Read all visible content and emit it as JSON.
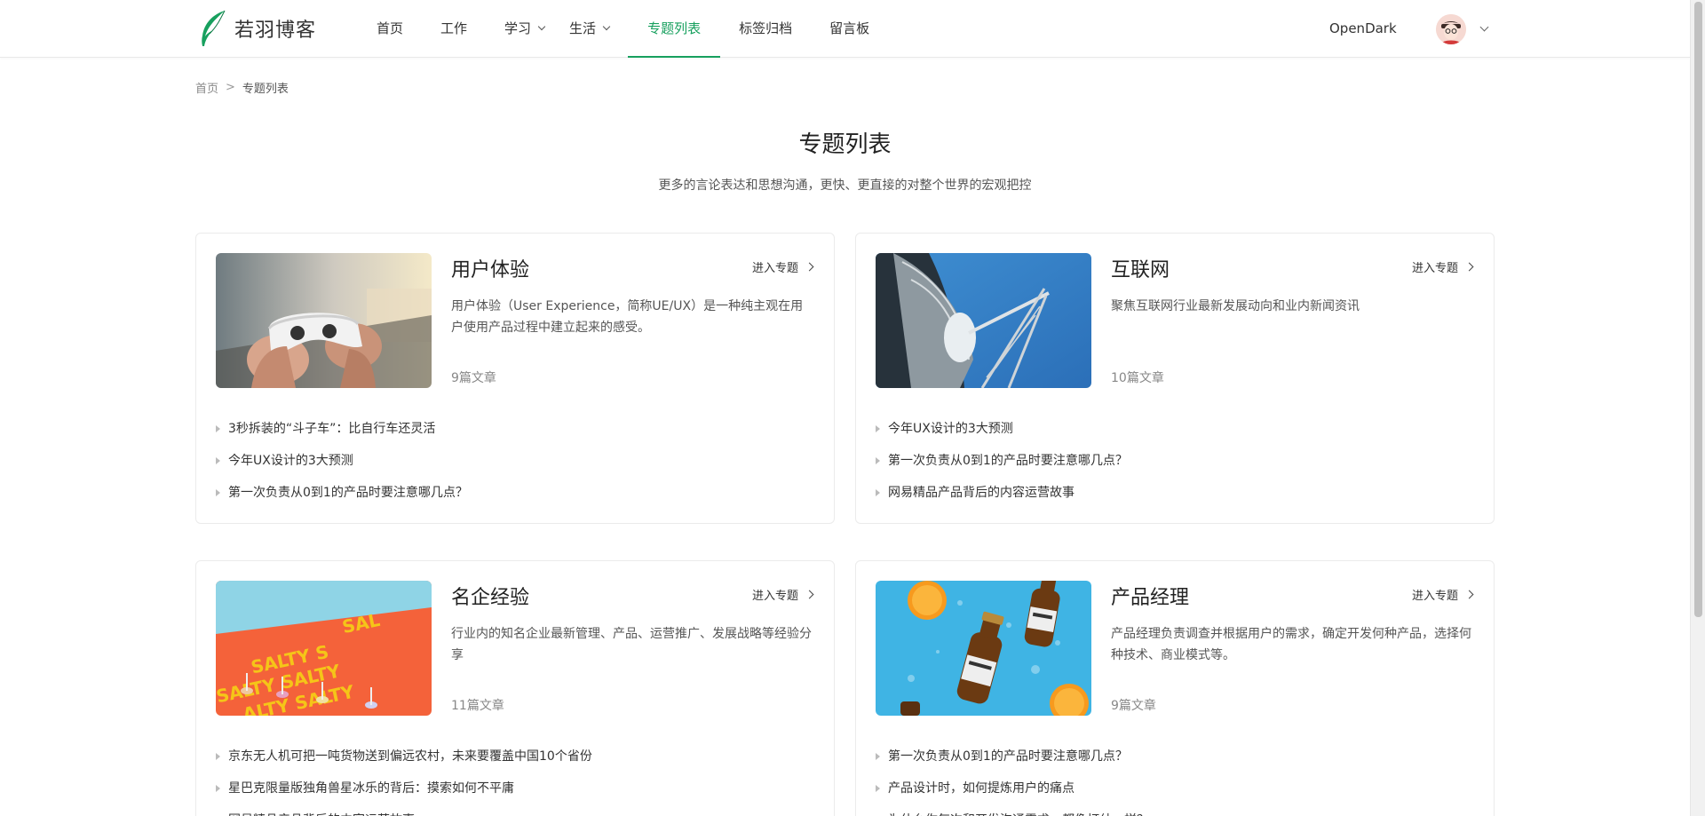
{
  "brand": {
    "name": "若羽博客",
    "accent": "#17a05e"
  },
  "nav": {
    "items": [
      {
        "label": "首页"
      },
      {
        "label": "工作"
      },
      {
        "label": "学习",
        "dropdown": true
      },
      {
        "label": "生活",
        "dropdown": true
      },
      {
        "label": "专题列表",
        "active": true
      },
      {
        "label": "标签归档"
      },
      {
        "label": "留言板"
      }
    ],
    "theme_link": "OpenDark"
  },
  "breadcrumb": {
    "home": "首页",
    "separator": ">",
    "current": "专题列表"
  },
  "page": {
    "title": "专题列表",
    "subtitle": "更多的言论表达和思想沟通，更快、更直接的对整个世界的宏观把控"
  },
  "topics": [
    {
      "title": "用户体验",
      "enter_label": "进入专题",
      "description": "用户体验（User Experience，简称UE/UX）是一种纯主观在用户使用产品过程中建立起来的感受。",
      "count": "9篇文章",
      "thumb": "game-controller-photo",
      "articles": [
        "3秒拆装的“斗子车”：比自行车还灵活",
        "今年UX设计的3大预测",
        "第一次负责从0到1的产品时要注意哪几点？"
      ]
    },
    {
      "title": "互联网",
      "enter_label": "进入专题",
      "description": "聚焦互联网行业最新发展动向和业内新闻资讯",
      "count": "10篇文章",
      "thumb": "satellite-dish-photo",
      "articles": [
        "今年UX设计的3大预测",
        "第一次负责从0到1的产品时要注意哪几点？",
        "网易精品产品背后的内容运营故事"
      ]
    },
    {
      "title": "名企经验",
      "enter_label": "进入专题",
      "description": "行业内的知名企业最新管理、产品、运营推广、发展战略等经验分享",
      "count": "11篇文章",
      "thumb": "salty-letters-photo",
      "articles": [
        "京东无人机可把一吨货物送到偏远农村，未来要覆盖中国10个省份",
        "星巴克限量版独角兽星冰乐的背后：摸索如何不平庸",
        "网易精品产品背后的内容运营故事"
      ]
    },
    {
      "title": "产品经理",
      "enter_label": "进入专题",
      "description": "产品经理负责调查并根据用户的需求，确定开发何种产品，选择何种技术、商业模式等。",
      "count": "9篇文章",
      "thumb": "tea-bottles-photo",
      "articles": [
        "第一次负责从0到1的产品时要注意哪几点？",
        "产品设计时，如何提炼用户的痛点",
        "为什么你每次和开发沟通需求，都像打仗一样？"
      ]
    }
  ]
}
